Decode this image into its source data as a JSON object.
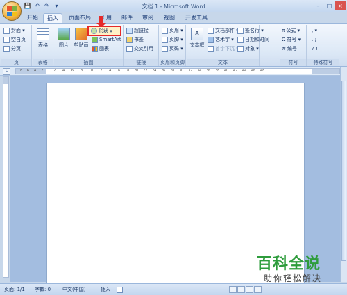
{
  "window": {
    "title": "文档 1 - Microsoft Word",
    "controls": {
      "minimize": "–",
      "restore": "□",
      "close": "×"
    }
  },
  "quick_access": {
    "save": "💾",
    "undo": "↶",
    "redo": "↷",
    "customize": "▾"
  },
  "tabs": [
    {
      "label": "开始",
      "active": false
    },
    {
      "label": "插入",
      "active": true
    },
    {
      "label": "页面布局",
      "active": false
    },
    {
      "label": "引用",
      "active": false
    },
    {
      "label": "邮件",
      "active": false
    },
    {
      "label": "审阅",
      "active": false
    },
    {
      "label": "视图",
      "active": false
    },
    {
      "label": "开发工具",
      "active": false
    }
  ],
  "ribbon": {
    "pages": {
      "label": "页",
      "items": [
        "封面 ▾",
        "空白页",
        "分页"
      ]
    },
    "tables": {
      "label": "表格",
      "button": "表格"
    },
    "illustrations": {
      "label": "插图",
      "picture": "图片",
      "clipart": "剪贴画",
      "shapes": "形状 ▾",
      "smartart": "SmartArt",
      "chart": "图表"
    },
    "links": {
      "label": "链接",
      "items": [
        "超链接",
        "书签",
        "交叉引用"
      ]
    },
    "header_footer": {
      "label": "页眉和页脚",
      "items": [
        "页眉 ▾",
        "页脚 ▾",
        "页码 ▾"
      ]
    },
    "text": {
      "label": "文本",
      "textbox": "文本框",
      "items": [
        "文档部件 ▾",
        "艺术字 ▾",
        "首字下沉 ▾",
        "签名行 ▾",
        "日期和时间",
        "对象 ▾"
      ]
    },
    "symbols": {
      "label": "符号",
      "items": [
        "公式 ▾",
        "符号 ▾",
        "编号"
      ]
    },
    "special": {
      "label": "特殊符号",
      "items": [
        ", ▾",
        ". ;",
        "? !"
      ]
    }
  },
  "ruler": {
    "numbers": [
      "8",
      "6",
      "4",
      "2",
      "2",
      "4",
      "6",
      "8",
      "10",
      "12",
      "14",
      "16",
      "18",
      "20",
      "22",
      "24",
      "26",
      "28",
      "30",
      "32",
      "34",
      "36",
      "38",
      "40",
      "42",
      "44",
      "46",
      "48"
    ]
  },
  "status_bar": {
    "page": "页面: 1/1",
    "words": "字数: 0",
    "language": "中文(中国)",
    "insert_mode": "插入"
  },
  "watermark": {
    "big": "百科全说",
    "small": "助你轻松解决"
  },
  "colors": {
    "highlight": "#e52a2a",
    "watermark": "#2e9c3c"
  }
}
